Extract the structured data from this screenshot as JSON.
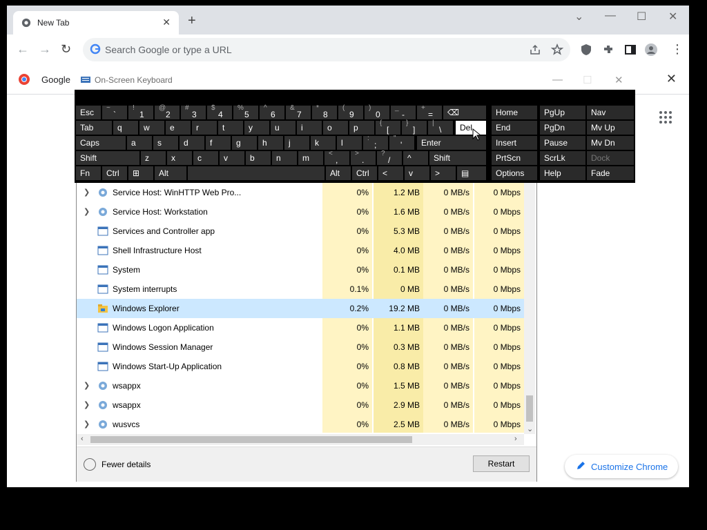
{
  "browser": {
    "tab_title": "New Tab",
    "omnibox_placeholder": "Search Google or type a URL",
    "bookmark_google": "Google",
    "customize_label": "Customize Chrome"
  },
  "osk": {
    "title": "On-Screen Keyboard",
    "rows": [
      [
        {
          "m": "Esc"
        },
        {
          "s": "~",
          "b": "`"
        },
        {
          "s": "!",
          "b": "1"
        },
        {
          "s": "@",
          "b": "2"
        },
        {
          "s": "#",
          "b": "3"
        },
        {
          "s": "$",
          "b": "4"
        },
        {
          "s": "%",
          "b": "5"
        },
        {
          "s": "^",
          "b": "6"
        },
        {
          "s": "&",
          "b": "7"
        },
        {
          "s": "*",
          "b": "8"
        },
        {
          "s": "(",
          "b": "9"
        },
        {
          "s": ")",
          "b": "0"
        },
        {
          "s": "_",
          "b": "-"
        },
        {
          "s": "+",
          "b": "="
        },
        {
          "m": "⌫"
        }
      ],
      [
        {
          "m": "Tab"
        },
        {
          "m": "q"
        },
        {
          "m": "w"
        },
        {
          "m": "e"
        },
        {
          "m": "r"
        },
        {
          "m": "t"
        },
        {
          "m": "y"
        },
        {
          "m": "u"
        },
        {
          "m": "i"
        },
        {
          "m": "o"
        },
        {
          "m": "p"
        },
        {
          "s": "{",
          "b": "["
        },
        {
          "s": "}",
          "b": "]"
        },
        {
          "s": "|",
          "b": "\\"
        },
        {
          "m": "Del"
        }
      ],
      [
        {
          "m": "Caps"
        },
        {
          "m": "a"
        },
        {
          "m": "s"
        },
        {
          "m": "d"
        },
        {
          "m": "f"
        },
        {
          "m": "g"
        },
        {
          "m": "h"
        },
        {
          "m": "j"
        },
        {
          "m": "k"
        },
        {
          "m": "l"
        },
        {
          "s": ":",
          "b": ";"
        },
        {
          "s": "\"",
          "b": "'"
        },
        {
          "m": "Enter"
        }
      ],
      [
        {
          "m": "Shift"
        },
        {
          "m": "z"
        },
        {
          "m": "x"
        },
        {
          "m": "c"
        },
        {
          "m": "v"
        },
        {
          "m": "b"
        },
        {
          "m": "n"
        },
        {
          "m": "m"
        },
        {
          "s": "<",
          "b": ","
        },
        {
          "s": ">",
          "b": "."
        },
        {
          "s": "?",
          "b": "/"
        },
        {
          "m": "^"
        },
        {
          "m": "Shift"
        }
      ],
      [
        {
          "m": "Fn"
        },
        {
          "m": "Ctrl"
        },
        {
          "m": "⊞"
        },
        {
          "m": "Alt"
        },
        {
          "m": ""
        },
        {
          "m": "Alt"
        },
        {
          "m": "Ctrl"
        },
        {
          "m": "<"
        },
        {
          "m": "v"
        },
        {
          "m": ">"
        },
        {
          "m": "▤"
        }
      ]
    ],
    "nav_rows": [
      [
        "Home",
        "PgUp",
        "Nav"
      ],
      [
        "End",
        "PgDn",
        "Mv Up"
      ],
      [
        "Insert",
        "Pause",
        "Mv Dn"
      ],
      [
        "PrtScn",
        "ScrLk",
        "Dock"
      ],
      [
        "Options",
        "Help",
        "Fade"
      ]
    ]
  },
  "task_manager": {
    "processes": [
      {
        "name": "Service Host: WinHTTP Web Pro...",
        "expand": true,
        "icon": "gear",
        "cpu": "0%",
        "mem": "1.2 MB",
        "disk": "0 MB/s",
        "net": "0 Mbps"
      },
      {
        "name": "Service Host: Workstation",
        "expand": true,
        "icon": "gear",
        "cpu": "0%",
        "mem": "1.6 MB",
        "disk": "0 MB/s",
        "net": "0 Mbps"
      },
      {
        "name": "Services and Controller app",
        "expand": false,
        "icon": "window",
        "cpu": "0%",
        "mem": "5.3 MB",
        "disk": "0 MB/s",
        "net": "0 Mbps"
      },
      {
        "name": "Shell Infrastructure Host",
        "expand": false,
        "icon": "window",
        "cpu": "0%",
        "mem": "4.0 MB",
        "disk": "0 MB/s",
        "net": "0 Mbps"
      },
      {
        "name": "System",
        "expand": false,
        "icon": "window",
        "cpu": "0%",
        "mem": "0.1 MB",
        "disk": "0 MB/s",
        "net": "0 Mbps"
      },
      {
        "name": "System interrupts",
        "expand": false,
        "icon": "window",
        "cpu": "0.1%",
        "mem": "0 MB",
        "disk": "0 MB/s",
        "net": "0 Mbps"
      },
      {
        "name": "Windows Explorer",
        "expand": false,
        "icon": "folder",
        "cpu": "0.2%",
        "mem": "19.2 MB",
        "disk": "0 MB/s",
        "net": "0 Mbps",
        "selected": true
      },
      {
        "name": "Windows Logon Application",
        "expand": false,
        "icon": "window",
        "cpu": "0%",
        "mem": "1.1 MB",
        "disk": "0 MB/s",
        "net": "0 Mbps"
      },
      {
        "name": "Windows Session Manager",
        "expand": false,
        "icon": "window",
        "cpu": "0%",
        "mem": "0.3 MB",
        "disk": "0 MB/s",
        "net": "0 Mbps"
      },
      {
        "name": "Windows Start-Up Application",
        "expand": false,
        "icon": "window",
        "cpu": "0%",
        "mem": "0.8 MB",
        "disk": "0 MB/s",
        "net": "0 Mbps"
      },
      {
        "name": "wsappx",
        "expand": true,
        "icon": "gear",
        "cpu": "0%",
        "mem": "1.5 MB",
        "disk": "0 MB/s",
        "net": "0 Mbps"
      },
      {
        "name": "wsappx",
        "expand": true,
        "icon": "gear",
        "cpu": "0%",
        "mem": "2.9 MB",
        "disk": "0 MB/s",
        "net": "0 Mbps"
      },
      {
        "name": "wusvcs",
        "expand": true,
        "icon": "gear",
        "cpu": "0%",
        "mem": "2.5 MB",
        "disk": "0 MB/s",
        "net": "0 Mbps"
      }
    ],
    "fewer_details": "Fewer details",
    "restart": "Restart"
  }
}
